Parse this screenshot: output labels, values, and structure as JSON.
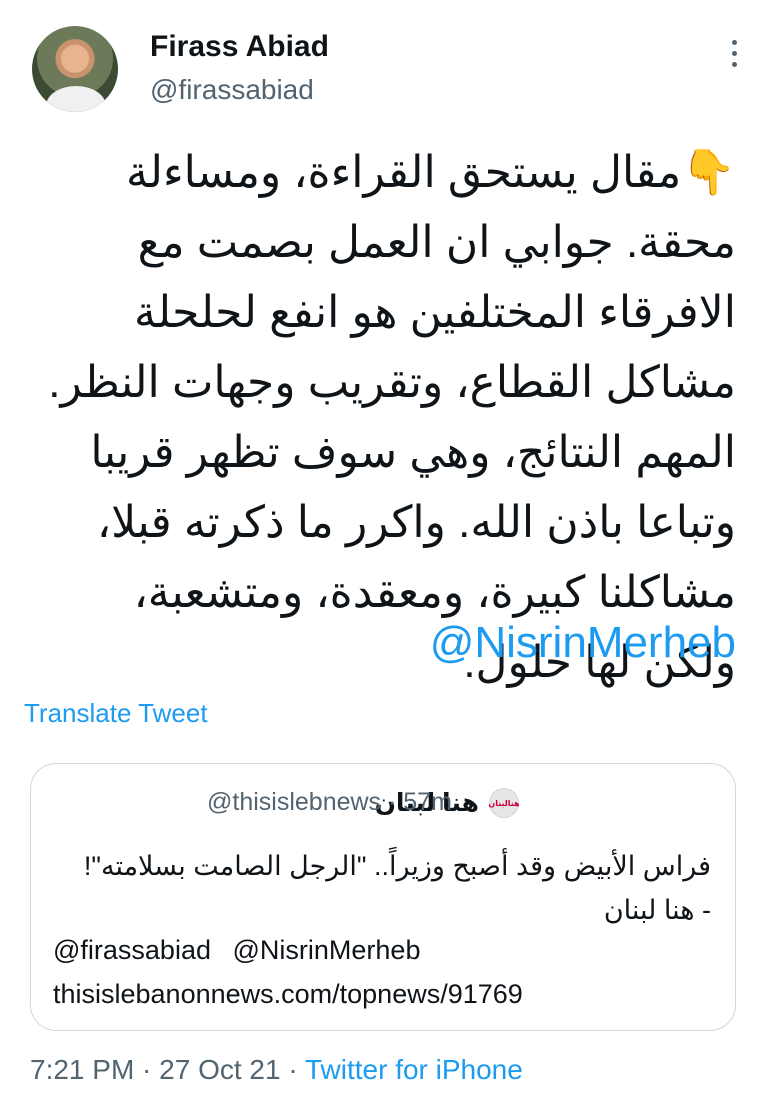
{
  "author": {
    "name": "Firass Abiad",
    "handle": "@firassabiad"
  },
  "tweet": {
    "text": "👇مقال يستحق القراءة، ومساءلة محقة. جوابي ان العمل بصمت مع الافرقاء المختلفين هو انفع لحلحلة مشاكل القطاع، وتقريب وجهات النظر. المهم النتائج، وهي سوف تظهر قريبا وتباعا باذن الله. واكرر ما ذكرته قبلا، مشاكلنا كبيرة، ومعقدة، ومتشعبة، ولكن لها حلول.",
    "mention": "@NisrinMerheb",
    "translate_label": "Translate Tweet"
  },
  "quote": {
    "avatar_text": "هنالبنان",
    "name": "هنا لبنان",
    "handle_time": "@thisislebnews · 57m",
    "text": "فراس الأبيض وقد أصبح وزيراً.. \"الرجل الصامت بسلامته\"! - هنا لبنان",
    "mention1": "@firassabiad",
    "mention2": "@NisrinMerheb",
    "link": "thisislebanonnews.com/topnews/91769"
  },
  "footer": {
    "time_date": "7:21 PM · 27 Oct 21 · ",
    "source": "Twitter for iPhone"
  }
}
